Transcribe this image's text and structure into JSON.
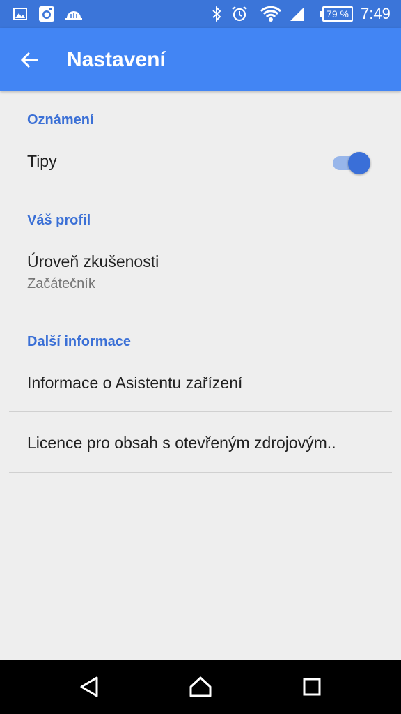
{
  "statusbar": {
    "battery": "79 %",
    "time": "7:49",
    "icons": [
      "gallery-icon",
      "instagram-icon",
      "cloud-icon",
      "bluetooth-icon",
      "alarm-icon",
      "wifi-icon",
      "signal-icon",
      "battery-icon"
    ]
  },
  "appbar": {
    "title": "Nastavení",
    "back_icon": "arrow-back-icon"
  },
  "sections": {
    "notifications": {
      "header": "Oznámení",
      "tips": {
        "title": "Tipy",
        "enabled": true
      }
    },
    "profile": {
      "header": "Váš profil",
      "experience": {
        "title": "Úroveň zkušenosti",
        "summary": "Začátečník"
      }
    },
    "more": {
      "header": "Další informace",
      "items": [
        {
          "title": "Informace o Asistentu zařízení"
        },
        {
          "title": "Licence pro obsah s otevřeným zdrojovým.."
        }
      ]
    }
  },
  "navbar": {
    "icons": [
      "back-triangle-icon",
      "home-icon",
      "recents-icon"
    ]
  },
  "colors": {
    "statusbar": "#3b75d9",
    "appbar": "#4285f4",
    "accent": "#3b70d6",
    "background": "#eeeeee"
  }
}
